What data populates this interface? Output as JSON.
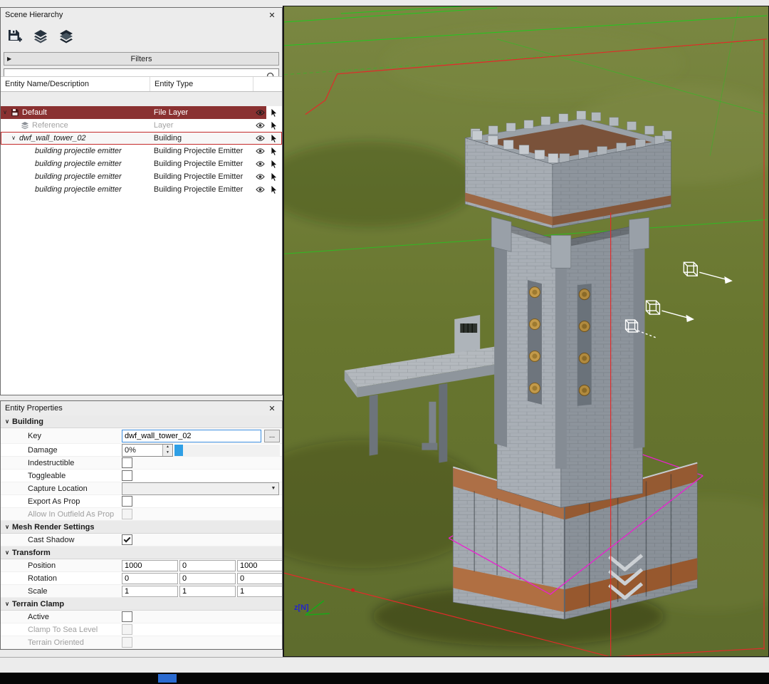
{
  "colors": {
    "selection_red": "#8a3131",
    "outline_red": "#c32b2b",
    "focus_blue": "#3d8fe0",
    "slider_blue": "#2f9fe5",
    "axis_blue": "#2424cc"
  },
  "glyphs": {
    "close": "✕",
    "expanded": "∨",
    "filters_arrow": "▶",
    "dropdown_arrow": "▼",
    "spin_up": "▲",
    "spin_down": "▼",
    "more": "..."
  },
  "scene_hierarchy": {
    "title": "Scene Hierarchy",
    "filters_label": "Filters",
    "columns": {
      "name": "Entity Name/Description",
      "type": "Entity Type"
    },
    "rows": [
      {
        "name": "Default",
        "type": "File Layer"
      },
      {
        "name": "Reference",
        "type": "Layer"
      },
      {
        "name": "dwf_wall_tower_02",
        "type": "Building"
      },
      {
        "name": "building projectile emitter",
        "type": "Building Projectile Emitter"
      },
      {
        "name": "building projectile emitter",
        "type": "Building Projectile Emitter"
      },
      {
        "name": "building projectile emitter",
        "type": "Building Projectile Emitter"
      },
      {
        "name": "building projectile emitter",
        "type": "Building Projectile Emitter"
      }
    ]
  },
  "entity_properties": {
    "title": "Entity Properties",
    "sections": {
      "building": "Building",
      "mesh": "Mesh Render Settings",
      "transform": "Transform",
      "terrain": "Terrain Clamp"
    },
    "key_label": "Key",
    "key_value": "dwf_wall_tower_02",
    "damage_label": "Damage",
    "damage_value": "0%",
    "indestructible_label": "Indestructible",
    "toggleable_label": "Toggleable",
    "capture_location_label": "Capture Location",
    "capture_location_value": "",
    "export_as_prop_label": "Export As Prop",
    "allow_outfield_label": "Allow In Outfield As Prop",
    "cast_shadow_label": "Cast Shadow",
    "position_label": "Position",
    "position": [
      "1000",
      "0",
      "1000"
    ],
    "rotation_label": "Rotation",
    "rotation": [
      "0",
      "0",
      "0"
    ],
    "scale_label": "Scale",
    "scale": [
      "1",
      "1",
      "1"
    ],
    "active_label": "Active",
    "clamp_sea_label": "Clamp To Sea Level",
    "terrain_oriented_label": "Terrain Oriented"
  },
  "viewport": {
    "axis_label": "z[N]"
  }
}
